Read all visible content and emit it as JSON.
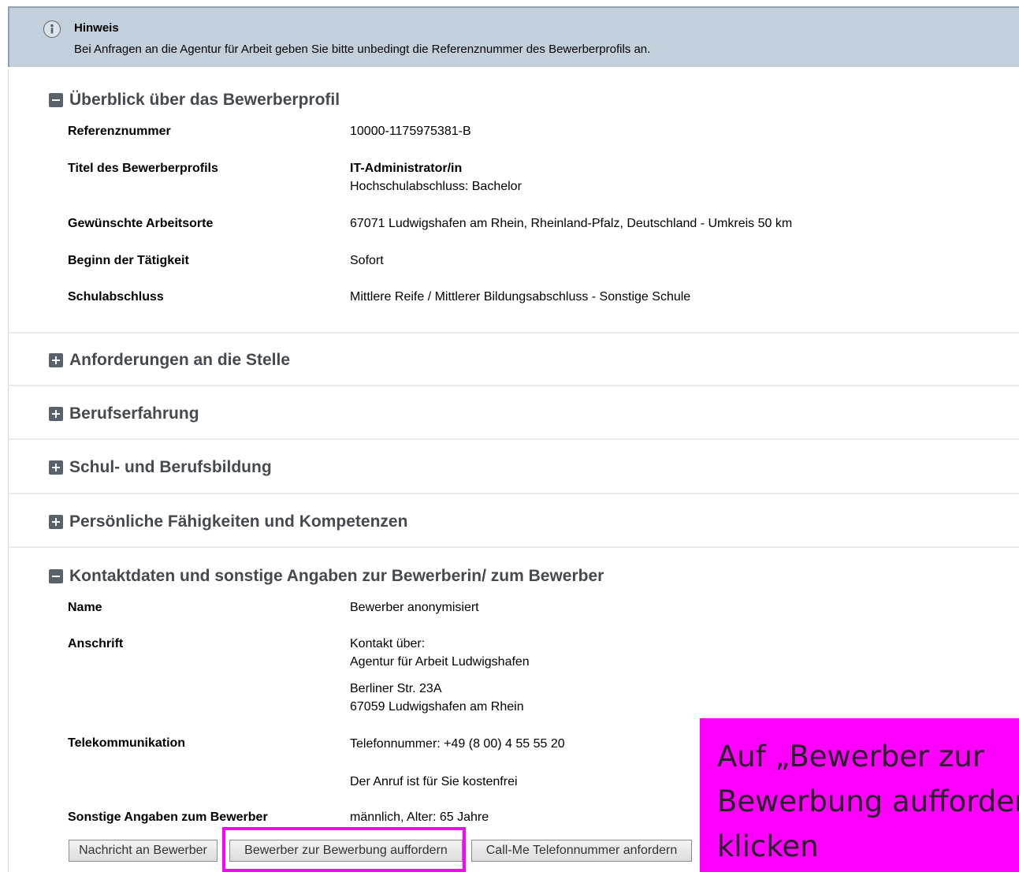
{
  "notice": {
    "icon": "info-icon",
    "title": "Hinweis",
    "text": "Bei Anfragen an die Agentur für Arbeit geben Sie bitte unbedingt die Referenznummer des Bewerberprofils an."
  },
  "overview": {
    "title": "Überblick über das Bewerberprofil",
    "state": "expanded",
    "rows": [
      {
        "label": "Referenznummer",
        "value": "10000-1175975381-B"
      },
      {
        "label": "Titel des Bewerberprofils",
        "value_bold": "IT-Administrator/in",
        "value": "Hochschulabschluss: Bachelor"
      },
      {
        "label": "Gewünschte Arbeitsorte",
        "value": "67071 Ludwigshafen am Rhein, Rheinland-Pfalz, Deutschland - Umkreis 50 km"
      },
      {
        "label": "Beginn der Tätigkeit",
        "value": "Sofort"
      },
      {
        "label": "Schulabschluss",
        "value": "Mittlere Reife / Mittlerer Bildungsabschluss - Sonstige Schule"
      }
    ]
  },
  "collapsed_sections": [
    {
      "title": "Anforderungen an die Stelle"
    },
    {
      "title": "Berufserfahrung"
    },
    {
      "title": "Schul- und Berufsbildung"
    },
    {
      "title": "Persönliche Fähigkeiten und Kompetenzen"
    }
  ],
  "contact": {
    "title": "Kontaktdaten und sonstige Angaben zur Bewerberin/ zum Bewerber",
    "state": "expanded",
    "name_label": "Name",
    "name_value": "Bewerber anonymisiert",
    "address_label": "Anschrift",
    "address_lines": [
      "Kontakt über:",
      "Agentur für Arbeit Ludwigshafen",
      "Berliner Str. 23A",
      "67059 Ludwigshafen am Rhein"
    ],
    "telecom_label": "Telekommunikation",
    "telecom_phone": "Telefonnummer: +49 (8 00) 4 55 55 20",
    "telecom_note": "Der Anruf ist für Sie kostenfrei",
    "other_label": "Sonstige Angaben zum Bewerber",
    "other_value": "männlich, Alter: 65 Jahre"
  },
  "buttons": {
    "message": "Nachricht an Bewerber",
    "invite": "Bewerber zur Bewerbung auffordern",
    "callme": "Call-Me Telefonnummer anfordern"
  },
  "annotation": {
    "text": "Auf „Bewerber zur Bewerbung auffordern“ klicken",
    "color": "#ff00ff"
  }
}
